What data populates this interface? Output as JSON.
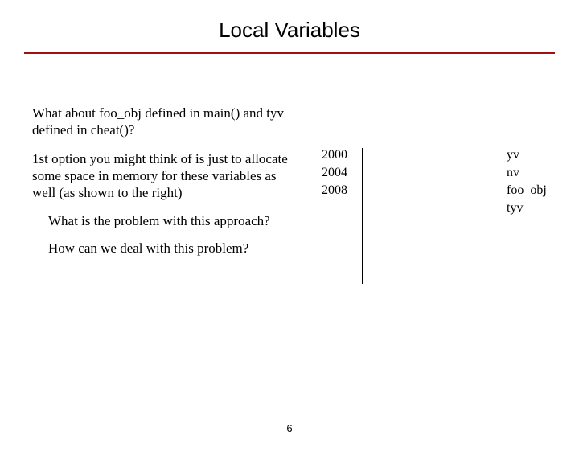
{
  "title": "Local Variables",
  "para1": "What about foo_obj defined in main() and tyv defined in cheat()?",
  "para2": "1st option you might think of is just to allocate some space in memory for these variables as well (as shown to the right)",
  "q1": "What is the problem with this approach?",
  "q2": "How can we deal with this problem?",
  "addresses": [
    "2000",
    "2004",
    "2008"
  ],
  "var_labels": [
    "yv",
    "nv",
    "foo_obj",
    "tyv"
  ],
  "page_number": "6"
}
